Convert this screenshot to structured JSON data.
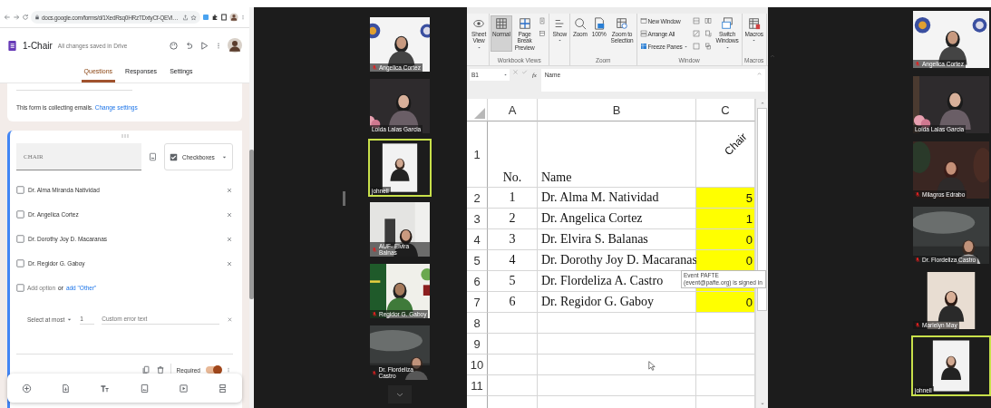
{
  "form_window": {
    "address": "docs.google.com/forms/d/1XedRsq0HRzTDxtyCf-QEVl…",
    "title": "1-Chair",
    "save_status": "All changes saved in Drive",
    "tabs": [
      {
        "label": "Questions",
        "selected": true
      },
      {
        "label": "Responses",
        "selected": false
      },
      {
        "label": "Settings",
        "selected": false
      }
    ],
    "email_notice": {
      "text": "This form is collecting emails.",
      "link": "Change settings"
    },
    "question": {
      "title": "CHAIR",
      "type": "Checkboxes",
      "options": [
        {
          "label": "Dr. Alma Miranda Natividad",
          "checked": false
        },
        {
          "label": "Dr. Angelica Cortez",
          "checked": false
        },
        {
          "label": "Dr. Dorothy Joy D. Macaranas",
          "checked": false
        },
        {
          "label": "Dr. Regidor G. Gaboy",
          "checked": false
        }
      ],
      "add_option": "Add option",
      "add_option_checked": false,
      "or": "or",
      "add_other": "add \"Other\"",
      "rule": "Select at most",
      "rule_count": "1",
      "error_placeholder": "Custom error text",
      "required_label": "Required",
      "required": true
    }
  },
  "video_left": {
    "tiles": [
      {
        "name": "Angelica Cortez",
        "muted": true,
        "active": false
      },
      {
        "name": "Loida Lalas Garcia",
        "muted": false,
        "active": false
      },
      {
        "name": "johnell",
        "muted": false,
        "active": true
      },
      {
        "name": "AUF- Elvira Balnas",
        "muted": true,
        "active": false
      },
      {
        "name": "Regidor G. Gaboy",
        "muted": true,
        "active": false
      },
      {
        "name": "Dr. Flordeliza Castro",
        "muted": true,
        "active": false
      }
    ]
  },
  "spreadsheet": {
    "ribbon": [
      {
        "buttons": [
          {
            "kind": "large",
            "label": "Sheet View",
            "menu": true
          }
        ]
      },
      {
        "label": "Workbook Views",
        "buttons": [
          {
            "kind": "large",
            "label": "Normal",
            "selected": true
          },
          {
            "kind": "large",
            "label": "Page Break Preview",
            "selected": false
          },
          {
            "kind": "small"
          },
          {
            "kind": "small"
          }
        ]
      },
      {
        "buttons": [
          {
            "kind": "large",
            "label": "Show",
            "menu": true
          }
        ]
      },
      {
        "label": "Zoom",
        "buttons": [
          {
            "kind": "large",
            "label": "Zoom"
          },
          {
            "kind": "large",
            "label": "100%"
          },
          {
            "kind": "large",
            "label": "Zoom to Selection"
          }
        ]
      },
      {
        "label": "Window",
        "buttons": [
          {
            "kind": "row",
            "label": "New Window"
          },
          {
            "kind": "row",
            "label": "Arrange All"
          },
          {
            "kind": "row",
            "label": "Freeze Panes",
            "menu": true
          },
          {
            "kind": "small"
          },
          {
            "kind": "small"
          },
          {
            "kind": "small"
          },
          {
            "kind": "small"
          },
          {
            "kind": "small"
          },
          {
            "kind": "small"
          },
          {
            "kind": "large",
            "label": "Switch Windows",
            "menu": true
          }
        ]
      },
      {
        "label": "Macros",
        "buttons": [
          {
            "kind": "large",
            "label": "Macros",
            "menu": true
          }
        ]
      }
    ],
    "name_box": "B1",
    "function_label": "fx",
    "formula": "Name",
    "columns": [
      "A",
      "B",
      "C"
    ],
    "rows": [
      {
        "kind": "heading",
        "number": "1",
        "no": "No.",
        "name": "Name",
        "chair": "Chair",
        "highlighted": false
      },
      {
        "kind": "data",
        "number": "2",
        "no": "1",
        "name": "Dr. Alma M. Natividad",
        "chair": "5",
        "highlighted": true
      },
      {
        "kind": "data",
        "number": "3",
        "no": "2",
        "name": "Dr. Angelica Cortez",
        "chair": "1",
        "highlighted": true
      },
      {
        "kind": "data",
        "number": "4",
        "no": "3",
        "name": "Dr. Elvira S. Balanas",
        "chair": "0",
        "highlighted": true
      },
      {
        "kind": "data",
        "number": "5",
        "no": "4",
        "name": "Dr. Dorothy Joy D. Macaranas",
        "chair": "0",
        "highlighted": true
      },
      {
        "kind": "data",
        "number": "6",
        "no": "5",
        "name": "Dr. Flordeliza A. Castro",
        "highlighted": true
      },
      {
        "kind": "data",
        "number": "7",
        "no": "6",
        "name": "Dr. Regidor G. Gaboy",
        "chair": "0",
        "highlighted": true
      },
      {
        "kind": "data",
        "number": "8",
        "highlighted": false
      },
      {
        "kind": "data",
        "number": "9",
        "highlighted": false
      },
      {
        "kind": "data",
        "number": "10",
        "highlighted": false
      },
      {
        "kind": "data",
        "number": "11",
        "highlighted": false
      }
    ],
    "tooltip": "Event PAFTE (event@pafte.org) is signed in"
  },
  "video_right": {
    "tiles": [
      {
        "name": "Angelica Cortez",
        "muted": true,
        "active": false
      },
      {
        "name": "Loida Lalas Garcia",
        "muted": false,
        "active": false
      },
      {
        "name": "Milagros Edrabo",
        "muted": true,
        "active": false
      },
      {
        "name": "Dr. Flordeliza Castro",
        "muted": true,
        "active": false
      },
      {
        "name": "Marielyn May",
        "muted": true,
        "active": false
      },
      {
        "name": "johnell",
        "muted": false,
        "active": true
      }
    ]
  }
}
